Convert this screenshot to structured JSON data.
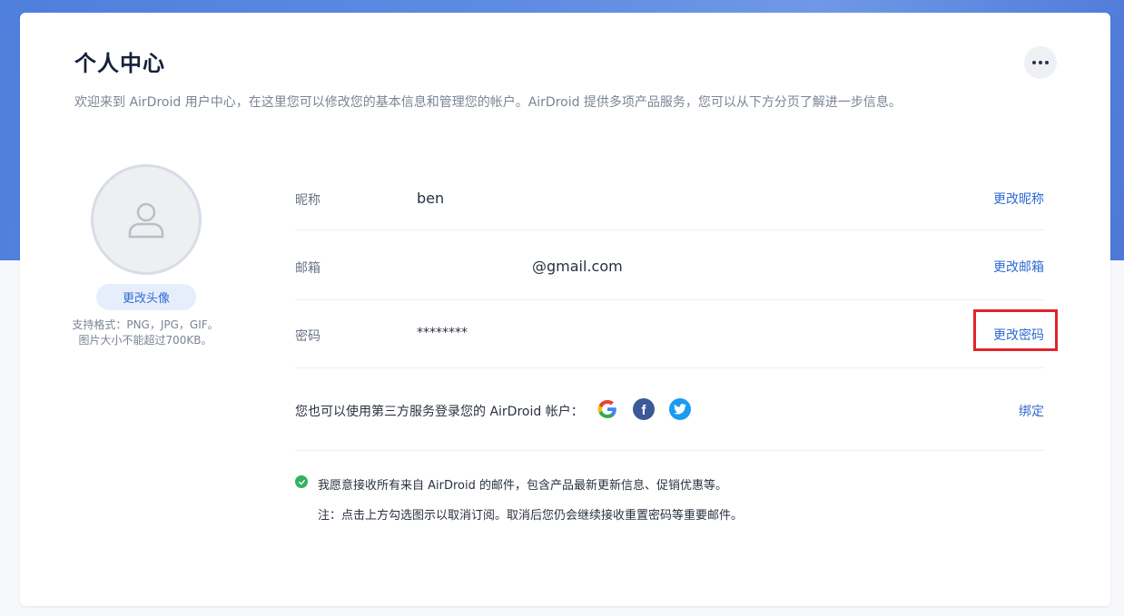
{
  "page": {
    "title": "个人中心",
    "subtitle": "欢迎来到 AirDroid 用户中心，在这里您可以修改您的基本信息和管理您的帐户。AirDroid 提供多项产品服务，您可以从下方分页了解进一步信息。"
  },
  "avatar": {
    "change_label": "更改头像",
    "hint_line1": "支持格式：PNG，JPG，GIF。",
    "hint_line2": "图片大小不能超过700KB。"
  },
  "profile": {
    "nickname": {
      "label": "昵称",
      "value": "ben",
      "action": "更改昵称"
    },
    "email": {
      "label": "邮箱",
      "value": "@gmail.com",
      "action": "更改邮箱"
    },
    "password": {
      "label": "密码",
      "value": "********",
      "action": "更改密码"
    }
  },
  "third_party": {
    "text": "您也可以使用第三方服务登录您的 AirDroid 帐户：",
    "providers": [
      "google-icon",
      "facebook-icon",
      "twitter-icon"
    ],
    "bind_label": "绑定"
  },
  "subscription": {
    "consent": "我愿意接收所有来自 AirDroid 的邮件，包含产品最新更新信息、促销优惠等。",
    "note": "注：点击上方勾选图示以取消订阅。取消后您仍会继续接收重置密码等重要邮件。",
    "checked": true
  },
  "colors": {
    "link": "#2f6ad0",
    "highlight": "#e0242b",
    "check": "#31b360",
    "header_bg": "#5f8ce2"
  }
}
